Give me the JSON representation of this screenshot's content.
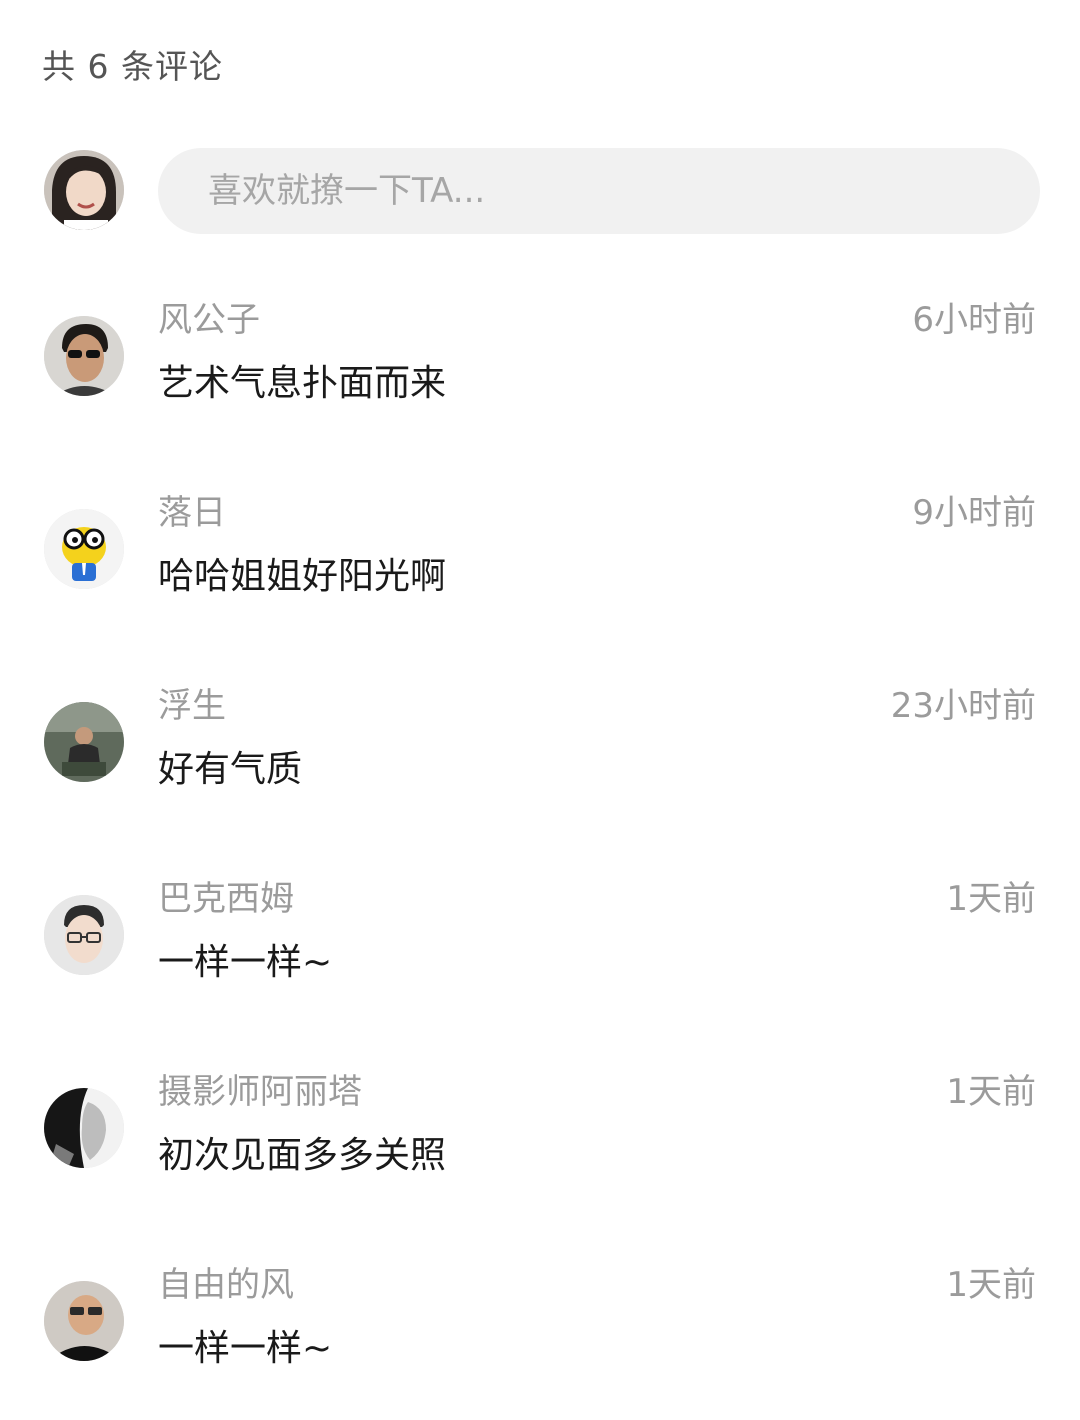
{
  "header": {
    "count_label": "共 6 条评论"
  },
  "composer": {
    "placeholder": "喜欢就撩一下TA...",
    "avatar_icon": "user-avatar"
  },
  "comments": [
    {
      "name": "风公子",
      "time": "6小时前",
      "text": "艺术气息扑面而来"
    },
    {
      "name": "落日",
      "time": "9小时前",
      "text": "哈哈姐姐好阳光啊"
    },
    {
      "name": "浮生",
      "time": "23小时前",
      "text": "好有气质"
    },
    {
      "name": "巴克西姆",
      "time": "1天前",
      "text": "一样一样~"
    },
    {
      "name": "摄影师阿丽塔",
      "time": "1天前",
      "text": "初次见面多多关照"
    },
    {
      "name": "自由的风",
      "time": "1天前",
      "text": "一样一样~"
    }
  ],
  "colors": {
    "meta_text": "#9b9b9b",
    "body_text": "#1a1a1a",
    "input_bg": "#f1f1f1"
  }
}
